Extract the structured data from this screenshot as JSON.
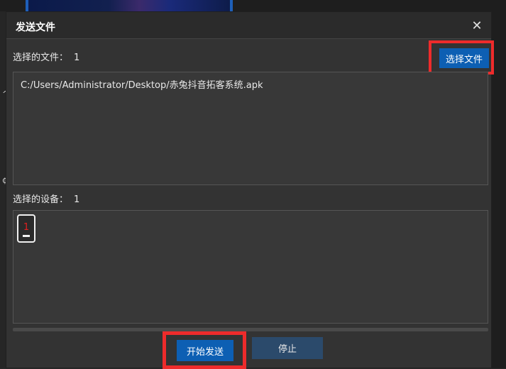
{
  "dialog": {
    "title": "发送文件",
    "close_glyph": "✕"
  },
  "files": {
    "label": "选择的文件：",
    "count": "1",
    "choose_button": "选择文件",
    "items": [
      "C:/Users/Administrator/Desktop/赤兔抖音拓客系统.apk"
    ]
  },
  "devices": {
    "label": "选择的设备：",
    "count": "1",
    "items": [
      {
        "number": "1"
      }
    ]
  },
  "actions": {
    "start_button": "开始发送",
    "stop_button": "停止"
  },
  "background": {
    "side_glyphs": [
      "^",
      "₵"
    ]
  },
  "colors": {
    "accent": "#0d5fb3",
    "highlight": "#ee2b2b",
    "device_number": "#e02020",
    "dialog_bg": "#333333"
  }
}
